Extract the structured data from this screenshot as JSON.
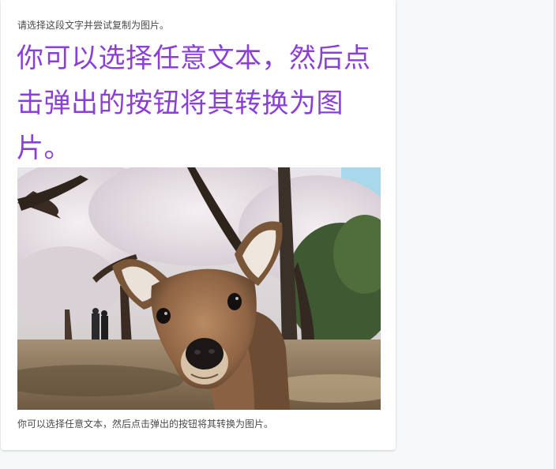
{
  "card": {
    "instruction": "请选择这段文字并尝试复制为图片。",
    "headline": "你可以选择任意文本，然后点击弹出的按钮将其转换为图片。",
    "image_alt": "deer under cherry blossom trees",
    "caption": "你可以选择任意文本，然后点击弹出的按钮将其转换为图片。"
  },
  "colors": {
    "headline": "#8a3fd6",
    "text": "#4a4a4a",
    "card_bg": "#ffffff",
    "page_bg": "#f7f8fa"
  }
}
